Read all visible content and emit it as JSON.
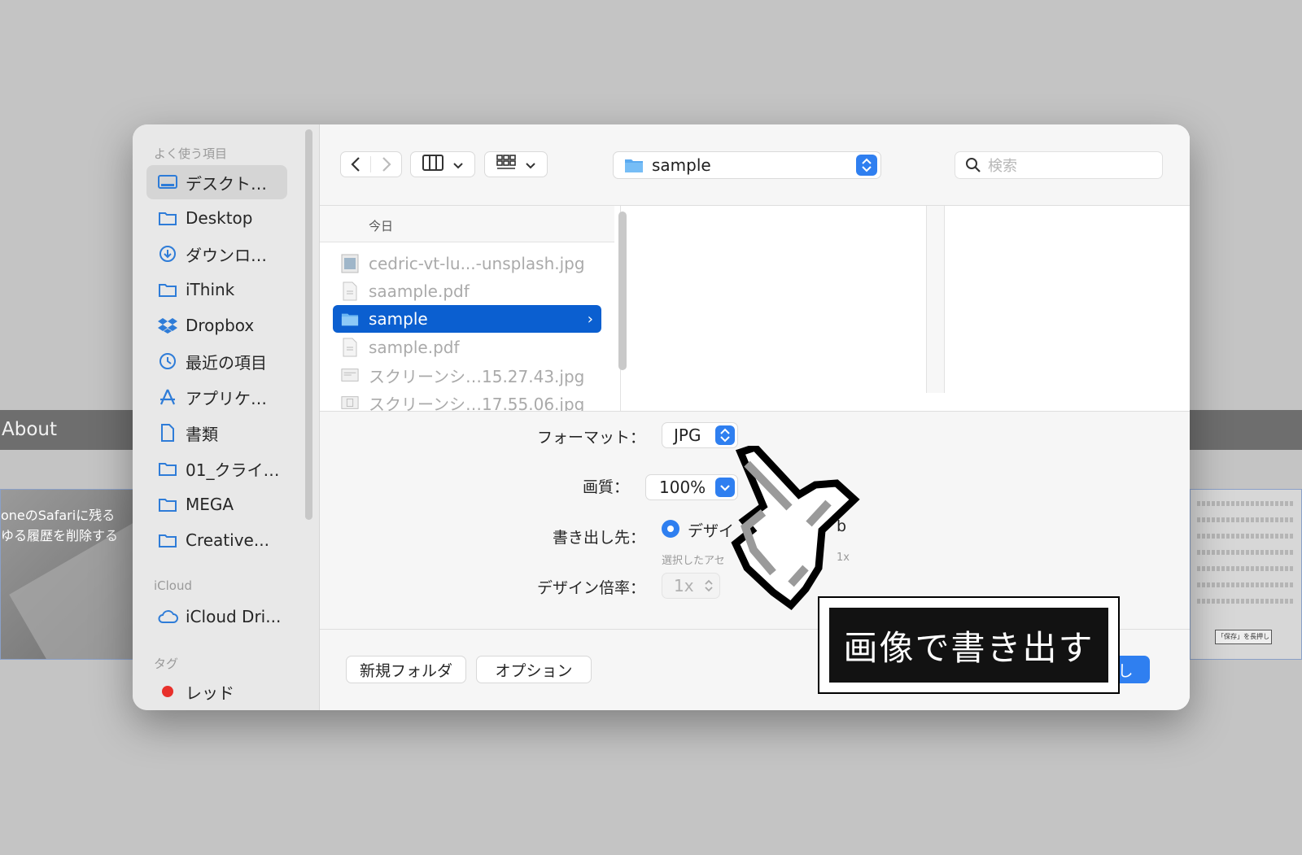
{
  "background": {
    "bar_label": "About",
    "left_card_text": [
      "oneのSafariに残る",
      "ゆる履歴を削除する"
    ],
    "right_card_button": "「保存」を長押し"
  },
  "sidebar": {
    "section_favorites": "よく使う項目",
    "items": [
      {
        "label": "デスクト…",
        "icon": "desktop-icon"
      },
      {
        "label": "Desktop",
        "icon": "folder-icon"
      },
      {
        "label": "ダウンロ…",
        "icon": "download-icon"
      },
      {
        "label": "iThink",
        "icon": "folder-icon"
      },
      {
        "label": "Dropbox",
        "icon": "dropbox-icon"
      },
      {
        "label": "最近の項目",
        "icon": "clock-icon"
      },
      {
        "label": "アプリケ…",
        "icon": "applications-icon"
      },
      {
        "label": "書類",
        "icon": "document-icon"
      },
      {
        "label": "01_クライ…",
        "icon": "folder-icon"
      },
      {
        "label": "MEGA",
        "icon": "folder-icon"
      },
      {
        "label": "Creative...",
        "icon": "folder-icon"
      }
    ],
    "section_icloud": "iCloud",
    "icloud_items": [
      {
        "label": "iCloud Dri...",
        "icon": "cloud-icon"
      }
    ],
    "section_tags": "タグ",
    "tag_items": [
      {
        "label": "レッド",
        "color": "#e8302b"
      }
    ]
  },
  "toolbar": {
    "back": "back",
    "forward": "forward",
    "path_label": "sample",
    "search_placeholder": "検索"
  },
  "browser": {
    "column_header": "今日",
    "files": [
      {
        "name": "cedric-vt-lu...-unsplash.jpg",
        "type": "image",
        "selected": false
      },
      {
        "name": "saample.pdf",
        "type": "pdf",
        "selected": false
      },
      {
        "name": "sample",
        "type": "folder",
        "selected": true
      },
      {
        "name": "sample.pdf",
        "type": "pdf",
        "selected": false
      },
      {
        "name": "スクリーンシ…15.27.43.jpg",
        "type": "image",
        "selected": false
      },
      {
        "name": "スクリーンシ…17.55.06.jpg",
        "type": "image",
        "selected": false
      }
    ]
  },
  "options": {
    "format_label": "フォーマット：",
    "format_value": "JPG",
    "quality_label": "画質：",
    "quality_value": "100%",
    "destination_label": "書き出し先：",
    "destination_option": "デザイ",
    "destination_sub": "選択したアセ",
    "destination_tail": "b",
    "destination_tail_sub": "1x",
    "scale_label": "デザイン倍率：",
    "scale_value": "1x"
  },
  "footer": {
    "new_folder": "新規フォルダ",
    "options": "オプション",
    "primary_partial": "し"
  },
  "callout": {
    "text": "画像で書き出す"
  },
  "colors": {
    "accent": "#2f7ff0",
    "selection": "#0b5fd0",
    "background": "#c4c4c4"
  }
}
